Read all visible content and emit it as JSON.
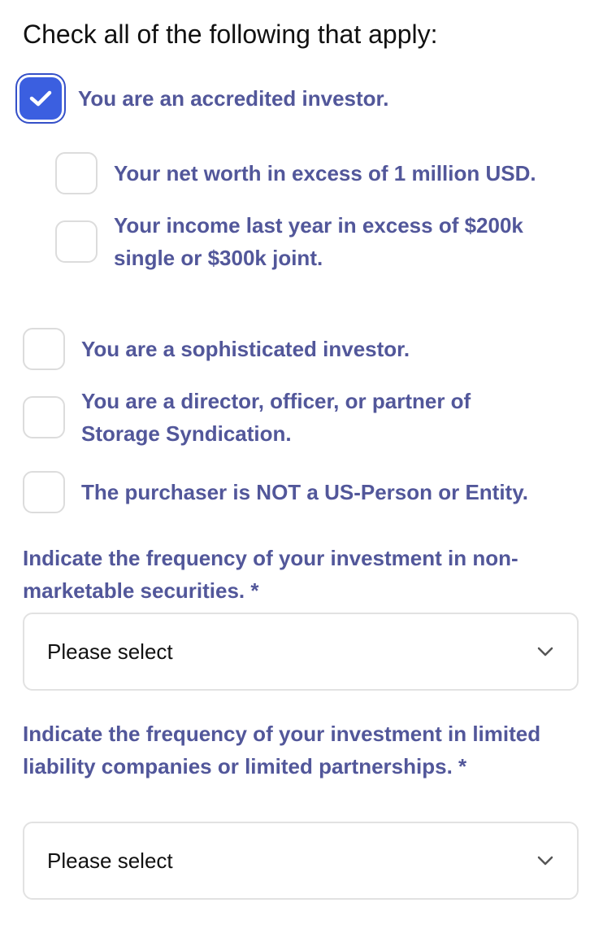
{
  "heading": "Check all of the following that apply:",
  "options": [
    {
      "label": "You are an accredited investor.",
      "checked": true
    },
    {
      "label": "Your net worth in excess of 1 million USD.",
      "checked": false
    },
    {
      "label": "Your income last year in excess of $200k single or $300k joint.",
      "checked": false
    },
    {
      "label": "You are a sophisticated investor.",
      "checked": false
    },
    {
      "label": "You are a director, officer, or partner of Storage Syndication.",
      "checked": false
    },
    {
      "label": "The purchaser is NOT a US-Person or Entity.",
      "checked": false
    }
  ],
  "questions": [
    {
      "label": "Indicate the frequency of your investment in non-marketable securities. *",
      "selected": "Please select"
    },
    {
      "label": "Indicate the frequency of your investment in limited liability companies or limited partnerships. *",
      "selected": "Please select"
    }
  ],
  "colors": {
    "label": "#52579a",
    "checkbox_checked": "#3b5fe0",
    "checkbox_border": "#dcdcdc"
  },
  "icons": {
    "check": "checkmark-icon",
    "dropdown": "chevron-down-icon"
  }
}
